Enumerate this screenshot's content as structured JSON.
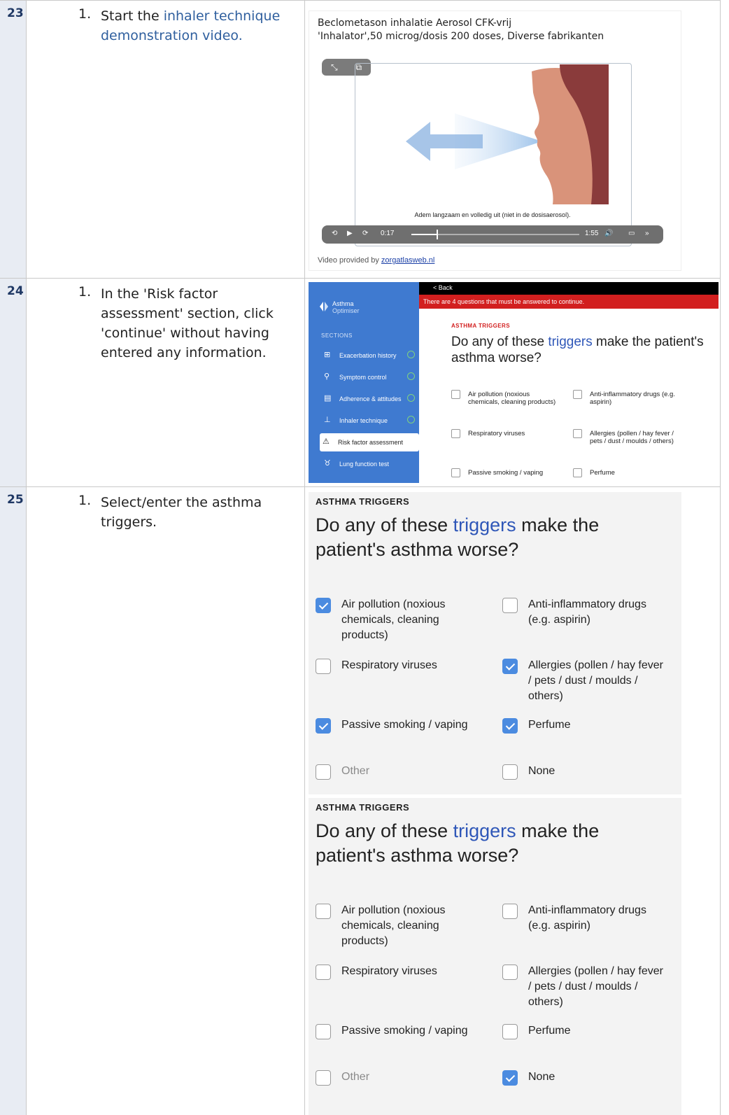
{
  "rows": [
    {
      "number": "23",
      "step": "1.",
      "text_prefix": "Start the ",
      "text_link": "inhaler technique demonstration video."
    },
    {
      "number": "24",
      "step": "1.",
      "text": "In the 'Risk factor assessment' section, click 'continue' without having entered any information."
    },
    {
      "number": "25",
      "step": "1.",
      "text": "Select/enter the asthma triggers."
    }
  ],
  "video": {
    "title_line1": "Beclometason inhalatie Aerosol CFK-vrij",
    "title_line2": "'Inhalator',50 microg/dosis 200 doses, Diverse fabrikanten",
    "caption": "Adem langzaam en volledig uit (niet in de dosisaerosol).",
    "current_time": "0:17",
    "duration": "1:55",
    "progress": 0.15,
    "provided_prefix": "Video provided by ",
    "provided_link": "zorgatlasweb.nl",
    "icons": [
      "expand-icon",
      "pip-icon",
      "rewind-15-icon",
      "play-icon",
      "forward-15-icon",
      "volume-icon",
      "airplay-icon",
      "chevron-double-right-icon"
    ]
  },
  "app": {
    "logo_line1": "Asthma",
    "logo_line2": "Optimiser",
    "sections_label": "SECTIONS",
    "header_back": "< Back",
    "alert": "There are 4 questions that must be answered to continue.",
    "sidebar": [
      {
        "label": "Exacerbation history",
        "done": true,
        "active": false
      },
      {
        "label": "Symptom control",
        "done": true,
        "active": false
      },
      {
        "label": "Adherence & attitudes",
        "done": true,
        "active": false
      },
      {
        "label": "Inhaler technique",
        "done": true,
        "active": false
      },
      {
        "label": "Risk factor assessment",
        "done": false,
        "active": true
      },
      {
        "label": "Lung function test",
        "done": false,
        "active": false
      }
    ],
    "kicker": "ASTHMA TRIGGERS",
    "question_pre": "Do any of these ",
    "question_hl": "triggers",
    "question_post": " make the patient's asthma worse?",
    "options": [
      "Air pollution (noxious chemicals, cleaning products)",
      "Anti-inflammatory drugs (e.g. aspirin)",
      "Respiratory viruses",
      "Allergies (pollen / hay fever / pets / dust / moulds / others)",
      "Passive smoking / vaping",
      "Perfume"
    ]
  },
  "panels": [
    {
      "kicker": "ASTHMA TRIGGERS",
      "question_pre": "Do any of these ",
      "question_hl": "triggers",
      "question_post": " make the patient's asthma worse?",
      "options": [
        {
          "label": "Air pollution (noxious chemicals, cleaning products)",
          "checked": true
        },
        {
          "label": "Anti-inflammatory drugs (e.g. aspirin)",
          "checked": false
        },
        {
          "label": "Respiratory viruses",
          "checked": false
        },
        {
          "label": "Allergies (pollen / hay fever / pets / dust / moulds / others)",
          "checked": true
        },
        {
          "label": "Passive smoking / vaping",
          "checked": true
        },
        {
          "label": "Perfume",
          "checked": true
        },
        {
          "label": "Other",
          "checked": false
        },
        {
          "label": "None",
          "checked": false
        }
      ]
    },
    {
      "kicker": "ASTHMA TRIGGERS",
      "question_pre": "Do any of these ",
      "question_hl": "triggers",
      "question_post": " make the patient's asthma worse?",
      "options": [
        {
          "label": "Air pollution (noxious chemicals, cleaning products)",
          "checked": false
        },
        {
          "label": "Anti-inflammatory drugs (e.g. aspirin)",
          "checked": false
        },
        {
          "label": "Respiratory viruses",
          "checked": false
        },
        {
          "label": "Allergies (pollen / hay fever / pets / dust / moulds / others)",
          "checked": false
        },
        {
          "label": "Passive smoking / vaping",
          "checked": false
        },
        {
          "label": "Perfume",
          "checked": false
        },
        {
          "label": "Other",
          "checked": false
        },
        {
          "label": "None",
          "checked": true
        }
      ]
    }
  ]
}
